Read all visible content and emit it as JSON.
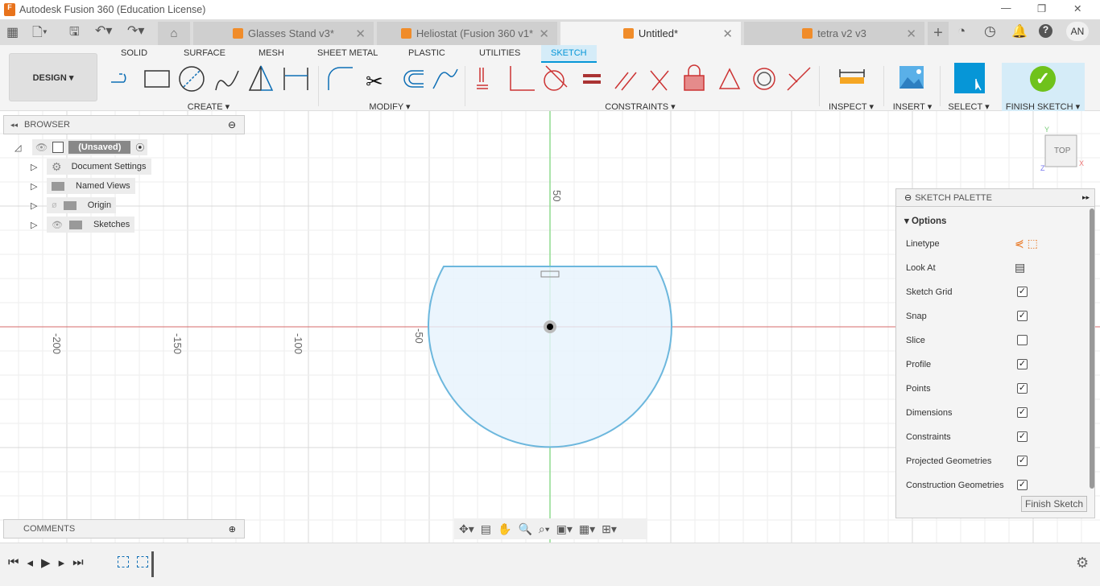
{
  "window": {
    "title": "Autodesk Fusion 360 (Education License)",
    "controls": [
      "—",
      "❐",
      "✕"
    ]
  },
  "tabs": [
    {
      "label": "Glasses Stand v3*",
      "active": false
    },
    {
      "label": "Heliostat (Fusion 360 v1*",
      "active": false
    },
    {
      "label": "Untitled*",
      "active": true
    },
    {
      "label": "tetra v2 v3",
      "active": false
    }
  ],
  "user": {
    "initials": "AN"
  },
  "ribbon": {
    "workspace": "DESIGN ▾",
    "tabs": [
      "SOLID",
      "SURFACE",
      "MESH",
      "SHEET METAL",
      "PLASTIC",
      "UTILITIES",
      "SKETCH"
    ],
    "active_tab": "SKETCH",
    "groups": [
      "CREATE ▾",
      "MODIFY ▾",
      "CONSTRAINTS ▾",
      "INSPECT ▾",
      "INSERT ▾",
      "SELECT ▾",
      "FINISH SKETCH ▾"
    ],
    "accent": "#0696d7",
    "finish_color": "#6fc21c"
  },
  "browser": {
    "title": "BROWSER",
    "root": "(Unsaved)",
    "items": [
      "Document Settings",
      "Named Views",
      "Origin",
      "Sketches"
    ]
  },
  "comments": {
    "title": "COMMENTS"
  },
  "viewcube": {
    "face": "TOP",
    "x": "X",
    "y": "Y",
    "z": "Z"
  },
  "axis_labels": {
    "x": [
      "-200",
      "-150",
      "-100",
      "-50"
    ],
    "y": [
      "50"
    ]
  },
  "palette": {
    "title": "SKETCH PALETTE",
    "section": "Options",
    "rows": [
      {
        "label": "Linetype",
        "type": "icons"
      },
      {
        "label": "Look At",
        "type": "icon"
      },
      {
        "label": "Sketch Grid",
        "checked": true
      },
      {
        "label": "Snap",
        "checked": true
      },
      {
        "label": "Slice",
        "checked": false
      },
      {
        "label": "Profile",
        "checked": true
      },
      {
        "label": "Points",
        "checked": true
      },
      {
        "label": "Dimensions",
        "checked": true
      },
      {
        "label": "Constraints",
        "checked": true
      },
      {
        "label": "Projected Geometries",
        "checked": true
      },
      {
        "label": "Construction Geometries",
        "checked": true
      }
    ],
    "finish_button": "Finish Sketch"
  }
}
